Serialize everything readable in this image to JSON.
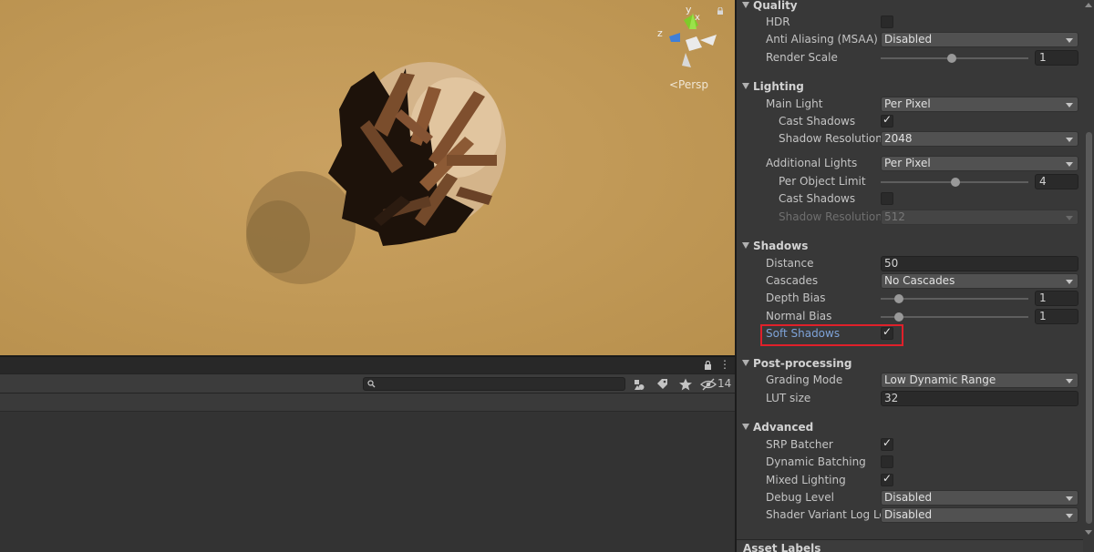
{
  "scene": {
    "view_label": "<Persp",
    "axis_y": "y",
    "axis_x": "x",
    "axis_z": "z"
  },
  "bottom_panel": {
    "hidden_count": "14",
    "search_placeholder": ""
  },
  "inspector": {
    "quality": {
      "title": "Quality",
      "hdr_label": "HDR",
      "hdr_checked": false,
      "aa_label": "Anti Aliasing (MSAA)",
      "aa_value": "Disabled",
      "render_scale_label": "Render Scale",
      "render_scale_value": "1",
      "render_scale_fraction": 0.5
    },
    "lighting": {
      "title": "Lighting",
      "main_light_label": "Main Light",
      "main_light_value": "Per Pixel",
      "cast_shadows_label": "Cast Shadows",
      "cast_shadows_checked": true,
      "shadow_res_label": "Shadow Resolution",
      "shadow_res_value": "2048",
      "additional_lights_label": "Additional Lights",
      "additional_lights_value": "Per Pixel",
      "per_object_limit_label": "Per Object Limit",
      "per_object_limit_value": "4",
      "per_object_limit_fraction": 0.5,
      "add_cast_shadows_label": "Cast Shadows",
      "add_cast_shadows_checked": false,
      "add_shadow_res_label": "Shadow Resolution",
      "add_shadow_res_value": "512"
    },
    "shadows": {
      "title": "Shadows",
      "distance_label": "Distance",
      "distance_value": "50",
      "cascades_label": "Cascades",
      "cascades_value": "No Cascades",
      "depth_bias_label": "Depth Bias",
      "depth_bias_value": "1",
      "depth_bias_fraction": 0.1,
      "normal_bias_label": "Normal Bias",
      "normal_bias_value": "1",
      "normal_bias_fraction": 0.1,
      "soft_shadows_label": "Soft Shadows",
      "soft_shadows_checked": true
    },
    "post_processing": {
      "title": "Post-processing",
      "grading_mode_label": "Grading Mode",
      "grading_mode_value": "Low Dynamic Range",
      "lut_size_label": "LUT size",
      "lut_size_value": "32"
    },
    "advanced": {
      "title": "Advanced",
      "srp_batcher_label": "SRP Batcher",
      "srp_batcher_checked": true,
      "dynamic_batching_label": "Dynamic Batching",
      "dynamic_batching_checked": false,
      "mixed_lighting_label": "Mixed Lighting",
      "mixed_lighting_checked": true,
      "debug_level_label": "Debug Level",
      "debug_level_value": "Disabled",
      "shader_variant_label": "Shader Variant Log Le",
      "shader_variant_value": "Disabled"
    },
    "asset_labels": "Asset Labels"
  },
  "colors": {
    "scene_ground": "#c29a58",
    "highlight_box": "#e0202a",
    "label_highlight": "#7ea3d8"
  }
}
